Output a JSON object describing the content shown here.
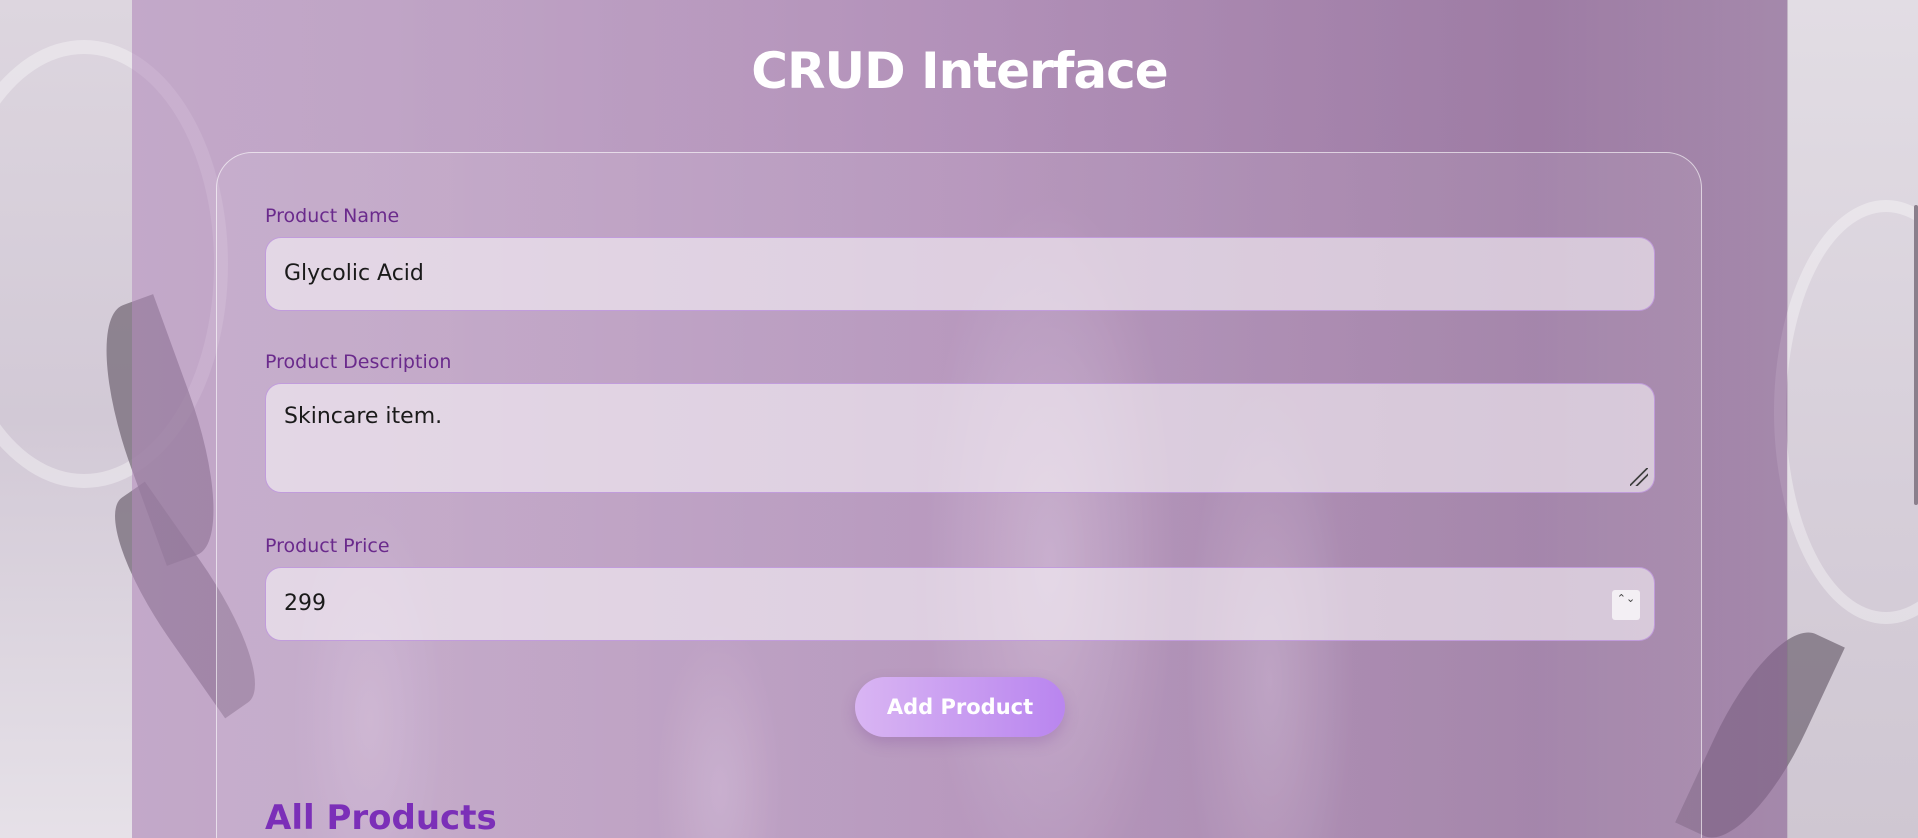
{
  "page": {
    "title": "CRUD Interface"
  },
  "form": {
    "name_label": "Product Name",
    "name_value": "Glycolic Acid",
    "description_label": "Product Description",
    "description_value": "Skincare item.",
    "price_label": "Product Price",
    "price_value": "299",
    "spinner_glyph": "⌃⌄",
    "submit_label": "Add Product"
  },
  "products": {
    "heading": "All Products"
  },
  "colors": {
    "label": "#6a2a8c",
    "heading": "#7b2fb8",
    "button_start": "#d9b5f3",
    "button_end": "#b985ef"
  }
}
